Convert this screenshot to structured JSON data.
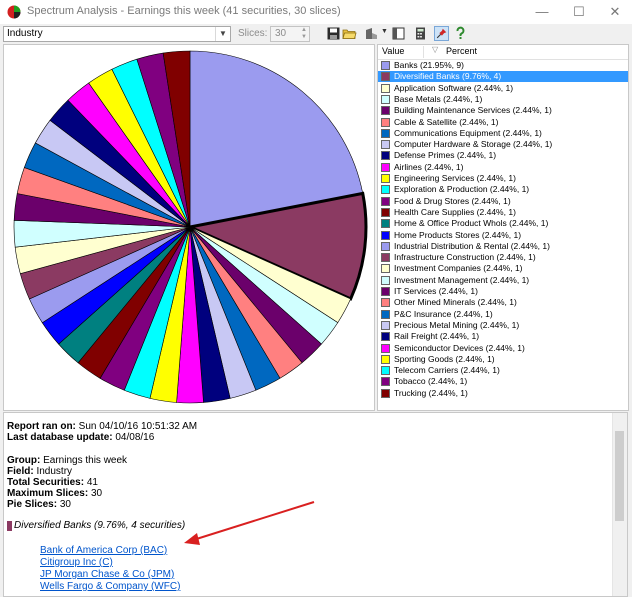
{
  "window": {
    "title": "Spectrum Analysis - Earnings this week (41 securities, 30 slices)",
    "controls": [
      "—",
      "☐",
      "✕"
    ]
  },
  "toolbar": {
    "field_value": "Industry",
    "slices_label": "Slices:",
    "slices_value": "30"
  },
  "legend": {
    "col_value": "Value",
    "col_percent": "Percent",
    "selected_index": 1
  },
  "chart_data": {
    "type": "pie",
    "slices": [
      {
        "label": "Banks (21.95%, 9)",
        "value": 21.95,
        "count": 9,
        "color": "#9b9bef"
      },
      {
        "label": "Diversified Banks (9.76%, 4)",
        "value": 9.76,
        "count": 4,
        "color": "#8b3a62"
      },
      {
        "label": "Application Software (2.44%, 1)",
        "value": 2.44,
        "count": 1,
        "color": "#ffffd0"
      },
      {
        "label": "Base Metals (2.44%, 1)",
        "value": 2.44,
        "count": 1,
        "color": "#d0ffff"
      },
      {
        "label": "Building Maintenance Services (2.44%, 1)",
        "value": 2.44,
        "count": 1,
        "color": "#6b006b"
      },
      {
        "label": "Cable & Satellite (2.44%, 1)",
        "value": 2.44,
        "count": 1,
        "color": "#ff8080"
      },
      {
        "label": "Communications Equipment (2.44%, 1)",
        "value": 2.44,
        "count": 1,
        "color": "#0068c0"
      },
      {
        "label": "Computer Hardware & Storage (2.44%, 1)",
        "value": 2.44,
        "count": 1,
        "color": "#c8c8f4"
      },
      {
        "label": "Defense Primes (2.44%, 1)",
        "value": 2.44,
        "count": 1,
        "color": "#00007e"
      },
      {
        "label": "Airlines (2.44%, 1)",
        "value": 2.44,
        "count": 1,
        "color": "#ff00ff"
      },
      {
        "label": "Engineering Services (2.44%, 1)",
        "value": 2.44,
        "count": 1,
        "color": "#ffff00"
      },
      {
        "label": "Exploration & Production (2.44%, 1)",
        "value": 2.44,
        "count": 1,
        "color": "#00ffff"
      },
      {
        "label": "Food & Drug Stores (2.44%, 1)",
        "value": 2.44,
        "count": 1,
        "color": "#800080"
      },
      {
        "label": "Health Care Supplies (2.44%, 1)",
        "value": 2.44,
        "count": 1,
        "color": "#800000"
      },
      {
        "label": "Home & Office Product Whols (2.44%, 1)",
        "value": 2.44,
        "count": 1,
        "color": "#008080"
      },
      {
        "label": "Home Products Stores (2.44%, 1)",
        "value": 2.44,
        "count": 1,
        "color": "#0000ff"
      },
      {
        "label": "Industrial Distribution & Rental (2.44%, 1)",
        "value": 2.44,
        "count": 1,
        "color": "#9b9bef"
      },
      {
        "label": "Infrastructure Construction (2.44%, 1)",
        "value": 2.44,
        "count": 1,
        "color": "#8b3a62"
      },
      {
        "label": "Investment Companies (2.44%, 1)",
        "value": 2.44,
        "count": 1,
        "color": "#ffffd0"
      },
      {
        "label": "Investment Management (2.44%, 1)",
        "value": 2.44,
        "count": 1,
        "color": "#d0ffff"
      },
      {
        "label": "IT Services (2.44%, 1)",
        "value": 2.44,
        "count": 1,
        "color": "#6b006b"
      },
      {
        "label": "Other Mined Minerals (2.44%, 1)",
        "value": 2.44,
        "count": 1,
        "color": "#ff8080"
      },
      {
        "label": "P&C Insurance (2.44%, 1)",
        "value": 2.44,
        "count": 1,
        "color": "#0068c0"
      },
      {
        "label": "Precious Metal Mining (2.44%, 1)",
        "value": 2.44,
        "count": 1,
        "color": "#c8c8f4"
      },
      {
        "label": "Rail Freight (2.44%, 1)",
        "value": 2.44,
        "count": 1,
        "color": "#00007e"
      },
      {
        "label": "Semiconductor Devices (2.44%, 1)",
        "value": 2.44,
        "count": 1,
        "color": "#ff00ff"
      },
      {
        "label": "Sporting Goods (2.44%, 1)",
        "value": 2.44,
        "count": 1,
        "color": "#ffff00"
      },
      {
        "label": "Telecom Carriers (2.44%, 1)",
        "value": 2.44,
        "count": 1,
        "color": "#00ffff"
      },
      {
        "label": "Tobacco (2.44%, 1)",
        "value": 2.44,
        "count": 1,
        "color": "#800080"
      },
      {
        "label": "Trucking (2.44%, 1)",
        "value": 2.44,
        "count": 1,
        "color": "#800000"
      }
    ]
  },
  "report": {
    "ran_label": "Report ran on:",
    "ran_value": "Sun 04/10/16 10:51:32 AM",
    "db_label": "Last database update:",
    "db_value": "04/08/16",
    "group_label": "Group:",
    "group_value": "Earnings this week",
    "field_label": "Field:",
    "field_value": "Industry",
    "total_label": "Total Securities:",
    "total_value": "41",
    "max_label": "Maximum Slices:",
    "max_value": "30",
    "pie_label": "Pie Slices:",
    "pie_value": "30",
    "selected_group": "Diversified Banks (9.76%, 4 securities)",
    "selected_color": "#8b3a62",
    "securities": [
      "Bank of America Corp (BAC)",
      "Citigroup Inc (C)",
      "JP Morgan Chase & Co (JPM)",
      "Wells Fargo & Company (WFC)"
    ]
  },
  "colors": {
    "selection": "#3399ff",
    "link": "#0055cc",
    "annotation_arrow": "#d92020"
  }
}
